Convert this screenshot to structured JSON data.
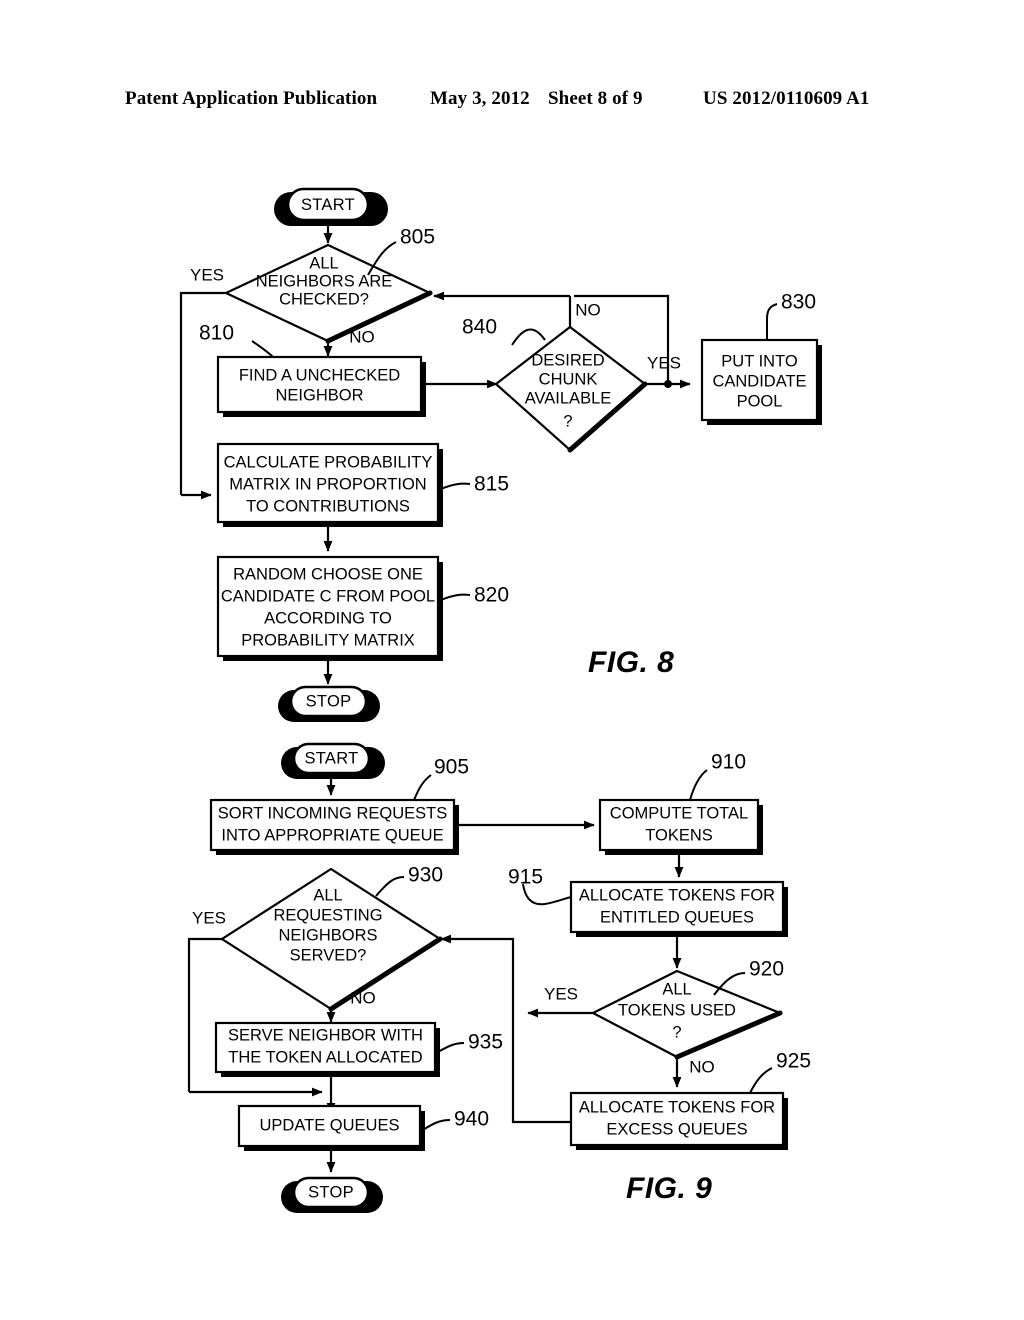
{
  "header": {
    "publication": "Patent Application Publication",
    "date": "May 3, 2012",
    "sheet": "Sheet 8 of 9",
    "number": "US 2012/0110609 A1"
  },
  "figures": [
    {
      "id": "fig8",
      "caption": "FIG. 8",
      "nodes": [
        {
          "ref": "",
          "type": "terminator",
          "label": "START"
        },
        {
          "ref": "805",
          "type": "decision",
          "label": "ALL NEIGHBORS ARE CHECKED?",
          "lines": [
            "ALL",
            "NEIGHBORS ARE",
            "CHECKED?"
          ],
          "branches": [
            "YES",
            "NO"
          ]
        },
        {
          "ref": "810",
          "type": "process",
          "label": "FIND A UNCHECKED NEIGHBOR",
          "lines": [
            "FIND A UNCHECKED",
            "NEIGHBOR"
          ]
        },
        {
          "ref": "840",
          "type": "decision",
          "label": "DESIRED CHUNK AVAILABLE ?",
          "lines": [
            "DESIRED",
            "CHUNK",
            "AVAILABLE",
            "?"
          ],
          "branches": [
            "NO",
            "YES"
          ]
        },
        {
          "ref": "830",
          "type": "process",
          "label": "PUT INTO CANDIDATE POOL",
          "lines": [
            "PUT INTO",
            "CANDIDATE",
            "POOL"
          ]
        },
        {
          "ref": "815",
          "type": "process",
          "label": "CALCULATE PROBABILITY MATRIX IN PROPORTION TO CONTRIBUTIONS",
          "lines": [
            "CALCULATE PROBABILITY",
            "MATRIX IN PROPORTION",
            "TO CONTRIBUTIONS"
          ]
        },
        {
          "ref": "820",
          "type": "process",
          "label": "RANDOM CHOOSE ONE CANDIDATE C FROM POOL ACCORDING TO PROBABILITY MATRIX",
          "lines": [
            "RANDOM CHOOSE ONE",
            "CANDIDATE C FROM POOL",
            "ACCORDING TO",
            "PROBABILITY MATRIX"
          ]
        },
        {
          "ref": "",
          "type": "terminator",
          "label": "STOP"
        }
      ]
    },
    {
      "id": "fig9",
      "caption": "FIG. 9",
      "nodes": [
        {
          "ref": "",
          "type": "terminator",
          "label": "START"
        },
        {
          "ref": "905",
          "type": "process",
          "label": "SORT INCOMING REQUESTS INTO APPROPRIATE QUEUE",
          "lines": [
            "SORT INCOMING REQUESTS",
            "INTO APPROPRIATE QUEUE"
          ]
        },
        {
          "ref": "910",
          "type": "process",
          "label": "COMPUTE TOTAL TOKENS",
          "lines": [
            "COMPUTE TOTAL",
            "TOKENS"
          ]
        },
        {
          "ref": "915",
          "type": "process",
          "label": "ALLOCATE TOKENS FOR ENTITLED QUEUES",
          "lines": [
            "ALLOCATE TOKENS FOR",
            "ENTITLED QUEUES"
          ]
        },
        {
          "ref": "920",
          "type": "decision",
          "label": "ALL TOKENS USED ?",
          "lines": [
            "ALL",
            "TOKENS USED",
            "?"
          ],
          "branches": [
            "YES",
            "NO"
          ]
        },
        {
          "ref": "925",
          "type": "process",
          "label": "ALLOCATE TOKENS FOR EXCESS QUEUES",
          "lines": [
            "ALLOCATE TOKENS FOR",
            "EXCESS QUEUES"
          ]
        },
        {
          "ref": "930",
          "type": "decision",
          "label": "ALL REQUESTING NEIGHBORS SERVED?",
          "lines": [
            "ALL",
            "REQUESTING",
            "NEIGHBORS",
            "SERVED?"
          ],
          "branches": [
            "YES",
            "NO"
          ]
        },
        {
          "ref": "935",
          "type": "process",
          "label": "SERVE NEIGHBOR WITH THE TOKEN ALLOCATED",
          "lines": [
            "SERVE NEIGHBOR WITH",
            "THE TOKEN ALLOCATED"
          ]
        },
        {
          "ref": "940",
          "type": "process",
          "label": "UPDATE QUEUES",
          "lines": [
            "UPDATE QUEUES"
          ]
        },
        {
          "ref": "",
          "type": "terminator",
          "label": "STOP"
        }
      ]
    }
  ],
  "fig8": {
    "start": "START",
    "stop": "STOP",
    "d805_l1": "ALL",
    "d805_l2": "NEIGHBORS ARE",
    "d805_l3": "CHECKED?",
    "d805_yes": "YES",
    "d805_no": "NO",
    "ref805": "805",
    "b810_l1": "FIND A UNCHECKED",
    "b810_l2": "NEIGHBOR",
    "ref810": "810",
    "d840_l1": "DESIRED",
    "d840_l2": "CHUNK",
    "d840_l3": "AVAILABLE",
    "d840_l4": "?",
    "d840_no": "NO",
    "d840_yes": "YES",
    "ref840": "840",
    "b830_l1": "PUT INTO",
    "b830_l2": "CANDIDATE",
    "b830_l3": "POOL",
    "ref830": "830",
    "b815_l1": "CALCULATE PROBABILITY",
    "b815_l2": "MATRIX IN PROPORTION",
    "b815_l3": "TO CONTRIBUTIONS",
    "ref815": "815",
    "b820_l1": "RANDOM CHOOSE ONE",
    "b820_l2": "CANDIDATE C FROM POOL",
    "b820_l3": "ACCORDING TO",
    "b820_l4": "PROBABILITY MATRIX",
    "ref820": "820",
    "caption": "FIG. 8"
  },
  "fig9": {
    "start": "START",
    "stop": "STOP",
    "b905_l1": "SORT INCOMING REQUESTS",
    "b905_l2": "INTO APPROPRIATE QUEUE",
    "ref905": "905",
    "b910_l1": "COMPUTE TOTAL",
    "b910_l2": "TOKENS",
    "ref910": "910",
    "b915_l1": "ALLOCATE TOKENS FOR",
    "b915_l2": "ENTITLED QUEUES",
    "ref915": "915",
    "d920_l1": "ALL",
    "d920_l2": "TOKENS USED",
    "d920_l3": "?",
    "d920_yes": "YES",
    "d920_no": "NO",
    "ref920": "920",
    "b925_l1": "ALLOCATE TOKENS FOR",
    "b925_l2": "EXCESS QUEUES",
    "ref925": "925",
    "d930_l1": "ALL",
    "d930_l2": "REQUESTING",
    "d930_l3": "NEIGHBORS",
    "d930_l4": "SERVED?",
    "d930_yes": "YES",
    "d930_no": "NO",
    "ref930": "930",
    "b935_l1": "SERVE NEIGHBOR WITH",
    "b935_l2": "THE TOKEN ALLOCATED",
    "ref935": "935",
    "b940_l1": "UPDATE QUEUES",
    "ref940": "940",
    "caption": "FIG. 9"
  }
}
